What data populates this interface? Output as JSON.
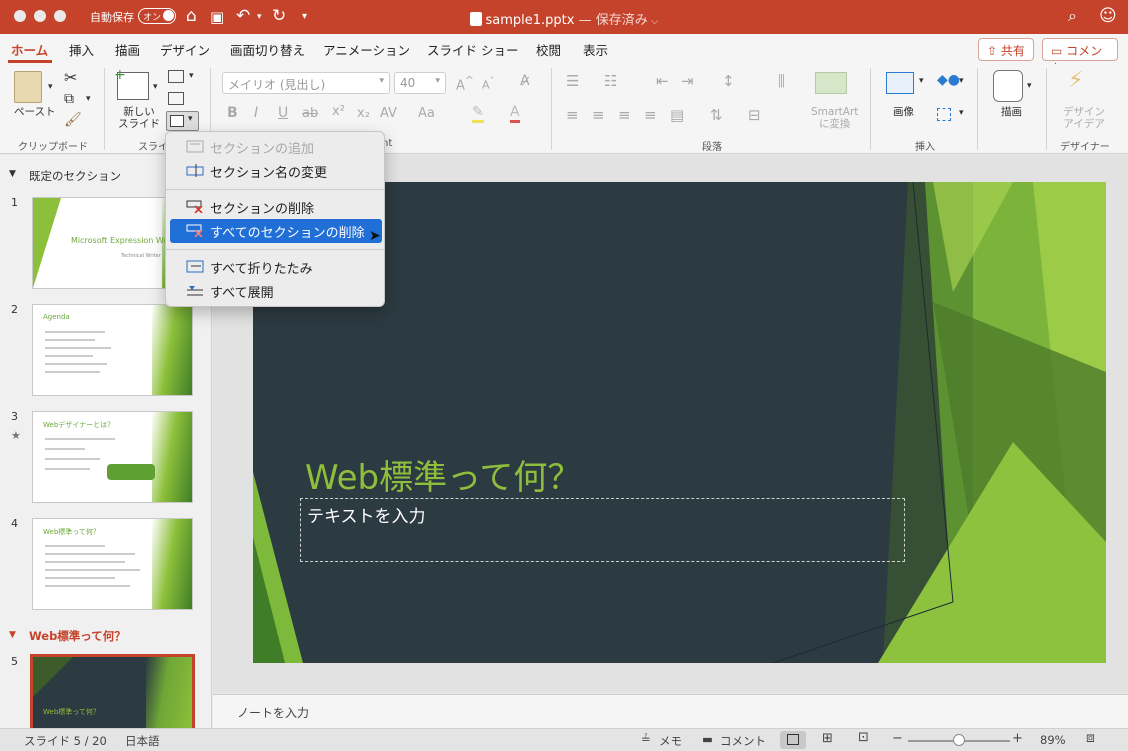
{
  "titlebar": {
    "autosave": "自動保存",
    "toggle": "オン",
    "filename": "sample1.pptx",
    "status": " — 保存済み"
  },
  "tabs": [
    "ホーム",
    "挿入",
    "描画",
    "デザイン",
    "画面切り替え",
    "アニメーション",
    "スライド ショー",
    "校閲",
    "表示"
  ],
  "share": "共有",
  "comment": "コメント",
  "ribbon": {
    "paste": "ペースト",
    "clipboard": "クリップボード",
    "newslide": "新しい\nスライド",
    "slide_group": "スライ",
    "font_name": "メイリオ (見出し)",
    "font_size": "40",
    "paragraph": "段落",
    "smartart": "SmartArt\nに変換",
    "image": "画像",
    "insert": "挿入",
    "draw": "描画",
    "design_idea": "デザイン\nアイデア",
    "designer": "デザイナー",
    "nt": "nt"
  },
  "menu": {
    "items": [
      "セクションの追加",
      "セクション名の変更",
      "セクションの削除",
      "すべてのセクションの削除",
      "すべて折りたたみ",
      "すべて展開"
    ]
  },
  "thumbs": {
    "section1": "既定のセクション",
    "section2": "Web標準って何？",
    "nums": [
      "1",
      "2",
      "3",
      "4",
      "5"
    ],
    "t1a": "Microsoft Expression Web",
    "t1b": "Technical Writer",
    "t2": "Agenda",
    "t3": "Webデザイナーとは？",
    "t4": "Web標準って何？",
    "t5": "Web標準って何？"
  },
  "slide": {
    "title": "Web標準って何？",
    "placeholder": "テキストを入力"
  },
  "notes": "ノートを入力",
  "status": {
    "slide": "スライド 5 / 20",
    "lang": "日本語",
    "memo": "メモ",
    "comment": "コメント",
    "zoom": "89%",
    "zoom_fraction": 0.5
  }
}
